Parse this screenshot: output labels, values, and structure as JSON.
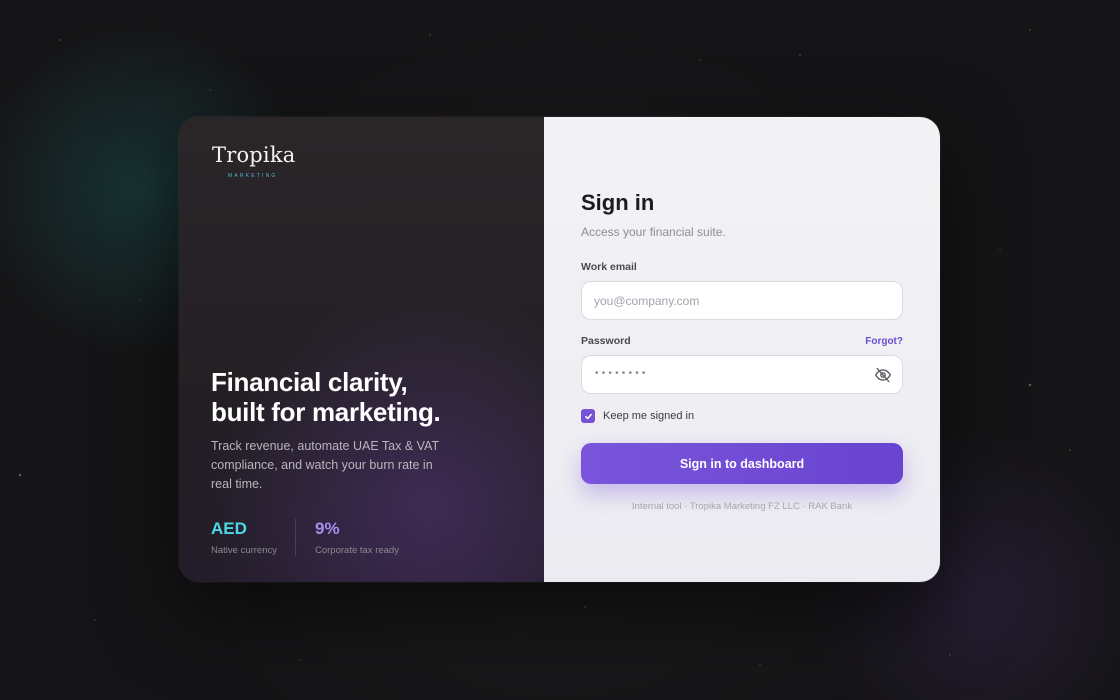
{
  "brand": {
    "name": "Tropika",
    "tagline": "MARKETING"
  },
  "hero": {
    "headline_line1": "Financial clarity,",
    "headline_line2": "built for marketing.",
    "description": "Track revenue, automate UAE Tax & VAT compliance, and watch your burn rate in real time."
  },
  "stats": [
    {
      "value": "AED",
      "label": "Native currency"
    },
    {
      "value": "9%",
      "label": "Corporate tax ready"
    }
  ],
  "form": {
    "title": "Sign in",
    "subtitle": "Access your financial suite.",
    "email_label": "Work email",
    "email_placeholder": "you@company.com",
    "email_value": "",
    "password_label": "Password",
    "password_mask": "••••••••",
    "forgot_label": "Forgot?",
    "remember_label": "Keep me signed in",
    "remember_checked": true,
    "submit_label": "Sign in to dashboard",
    "footer_note": "Internal tool · Tropika Marketing FZ LLC · RAK Bank"
  },
  "colors": {
    "accent": "#7552d6",
    "teal": "#4ad9e4",
    "lavender": "#a98cf0"
  },
  "icons": {
    "password_toggle": "eye-off-icon",
    "checkbox": "check-icon"
  }
}
